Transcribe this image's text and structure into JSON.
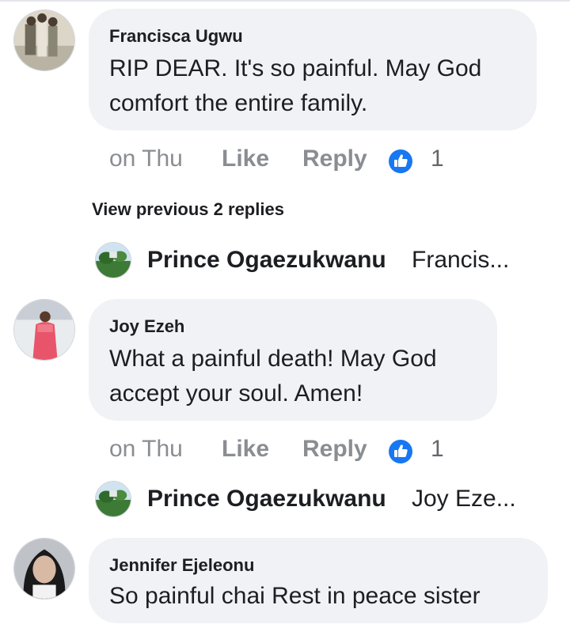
{
  "comments": [
    {
      "author": "Francisca Ugwu",
      "text_line1": "RIP DEAR. It's so painful. May God",
      "text_line2": "comfort the entire family.",
      "timestamp": "on Thu",
      "like_label": "Like",
      "reply_label": "Reply",
      "reaction_count": "1",
      "reaction_icon": "thumbs-up-icon"
    },
    {
      "author": "Joy Ezeh",
      "text_line1": "What a painful death! May God",
      "text_line2": "accept your soul. Amen!",
      "timestamp": "on Thu",
      "like_label": "Like",
      "reply_label": "Reply",
      "reaction_count": "1",
      "reaction_icon": "thumbs-up-icon"
    },
    {
      "author": "Jennifer Ejeleonu",
      "text_line1": "So painful chai Rest in peace sister"
    }
  ],
  "view_previous": "View previous 2 replies",
  "replies": [
    {
      "author": "Prince Ogaezukwanu",
      "snippet": "Francis..."
    },
    {
      "author": "Prince Ogaezukwanu",
      "snippet": "Joy Eze..."
    }
  ],
  "colors": {
    "bubble": "#f0f2f5",
    "action_text": "#8a8d91",
    "like_blue": "#1877f2"
  }
}
